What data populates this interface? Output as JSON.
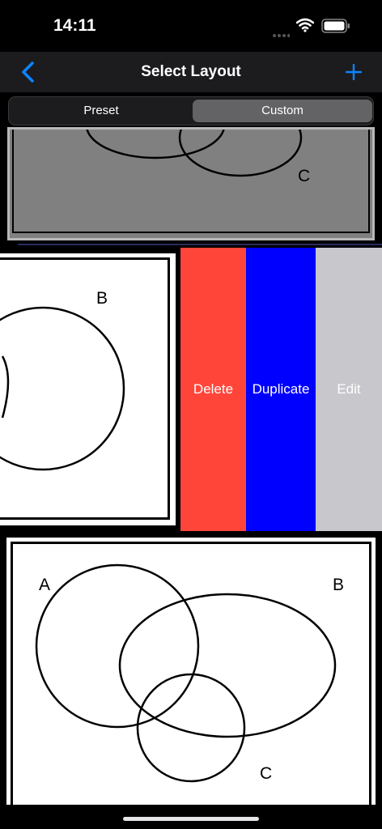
{
  "status_bar": {
    "time": "14:11"
  },
  "nav": {
    "title": "Select Layout",
    "back_icon": "chevron-left-icon",
    "add_icon": "plus-icon",
    "accent": "#0a84ff"
  },
  "segment": {
    "items": [
      {
        "label": "Preset",
        "selected": false
      },
      {
        "label": "Custom",
        "selected": true
      }
    ]
  },
  "layouts": [
    {
      "labels": [
        "C"
      ]
    },
    {
      "labels": [
        "B"
      ]
    },
    {
      "labels": [
        "A",
        "B",
        "C"
      ]
    }
  ],
  "swipe_actions": [
    {
      "label": "Delete",
      "color": "#ff453a"
    },
    {
      "label": "Duplicate",
      "color": "#0000ff"
    },
    {
      "label": "Edit",
      "color": "#c7c7cc"
    }
  ]
}
